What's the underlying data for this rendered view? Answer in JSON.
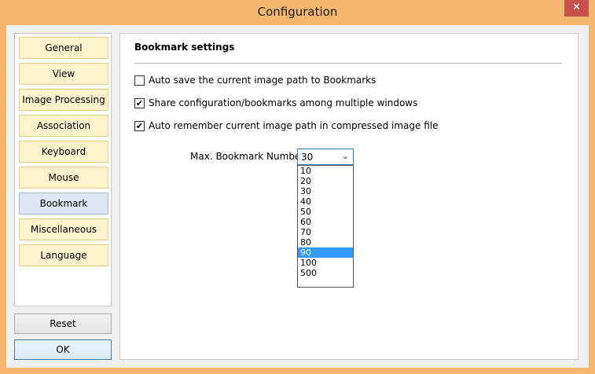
{
  "window": {
    "title": "Configuration",
    "close_glyph": "✕"
  },
  "nav": {
    "items": [
      {
        "label": "General"
      },
      {
        "label": "View"
      },
      {
        "label": "Image Processing"
      },
      {
        "label": "Association"
      },
      {
        "label": "Keyboard"
      },
      {
        "label": "Mouse"
      },
      {
        "label": "Bookmark",
        "active": true
      },
      {
        "label": "Miscellaneous"
      },
      {
        "label": "Language"
      }
    ],
    "reset_label": "Reset",
    "ok_label": "OK"
  },
  "settings": {
    "section_title": "Bookmark settings",
    "options": [
      {
        "label": "Auto save the current image path to Bookmarks",
        "checked": false
      },
      {
        "label": "Share configuration/bookmarks among multiple windows",
        "checked": true
      },
      {
        "label": "Auto remember current image path in compressed image file",
        "checked": true
      }
    ],
    "max_bookmark": {
      "label": "Max. Bookmark Number:",
      "value": "30",
      "options": [
        "10",
        "20",
        "30",
        "40",
        "50",
        "60",
        "70",
        "80",
        "90",
        "100",
        "500"
      ],
      "highlighted": "90"
    }
  },
  "icons": {
    "dropdown_arrow": "chevron-down-icon",
    "check": "check-icon"
  },
  "colors": {
    "title_bar": "#f6b76e",
    "close_button": "#c7504c",
    "nav_item": "#fff3cd",
    "nav_active": "#dfe6f2",
    "highlight": "#3399ff"
  }
}
